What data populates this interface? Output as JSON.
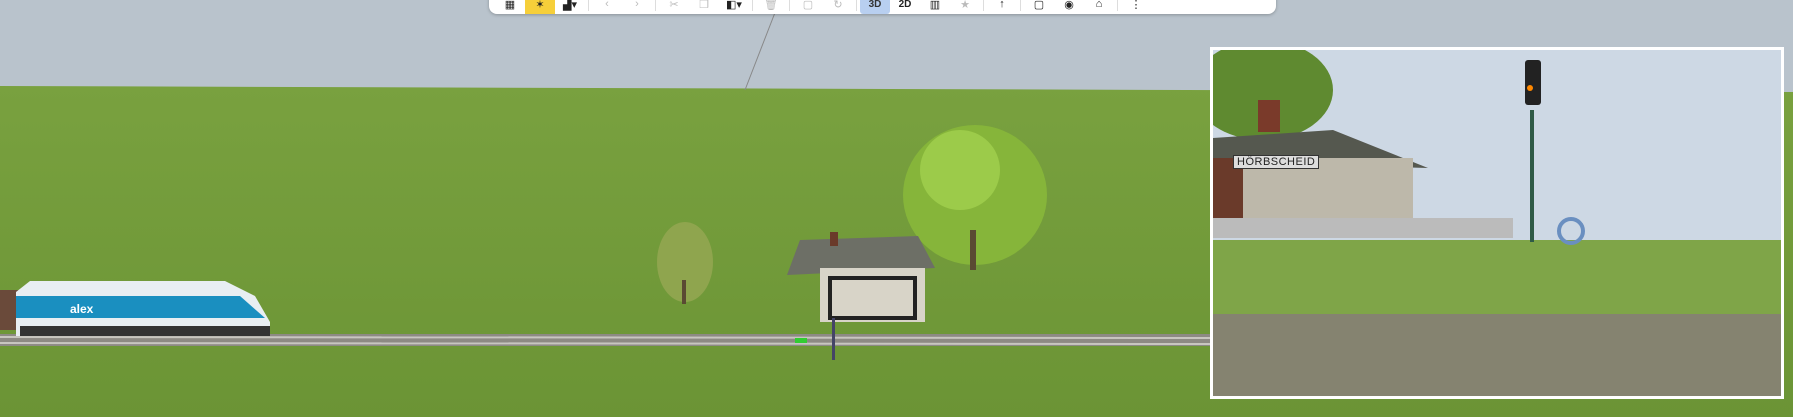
{
  "toolbar": {
    "buttons": [
      {
        "icon": "building-icon",
        "state": "normal"
      },
      {
        "icon": "walk-icon",
        "state": "active"
      },
      {
        "icon": "add-object-icon",
        "state": "normal"
      },
      {
        "icon": "undo-icon",
        "state": "disabled"
      },
      {
        "icon": "redo-icon",
        "state": "disabled"
      },
      {
        "icon": "cut-icon",
        "state": "disabled"
      },
      {
        "icon": "copy-icon",
        "state": "disabled"
      },
      {
        "icon": "paste-icon",
        "state": "normal"
      },
      {
        "icon": "delete-icon",
        "state": "disabled"
      },
      {
        "icon": "duplicate-icon",
        "state": "disabled"
      },
      {
        "icon": "rotate-icon",
        "state": "disabled"
      }
    ],
    "view_3d_label": "3D",
    "view_2d_label": "2D",
    "more_icons": [
      "catalog-icon",
      "favorite-icon",
      "up-icon",
      "layer-icon",
      "camera-icon",
      "home-icon",
      "more-icon"
    ]
  },
  "inset": {
    "station_name": "HÖRBSCHEID"
  },
  "colors": {
    "sky": "#b9c3cc",
    "grass": "#6f9a3a",
    "highlight": "#f6cf3a",
    "active_view": "#b8cff0"
  }
}
